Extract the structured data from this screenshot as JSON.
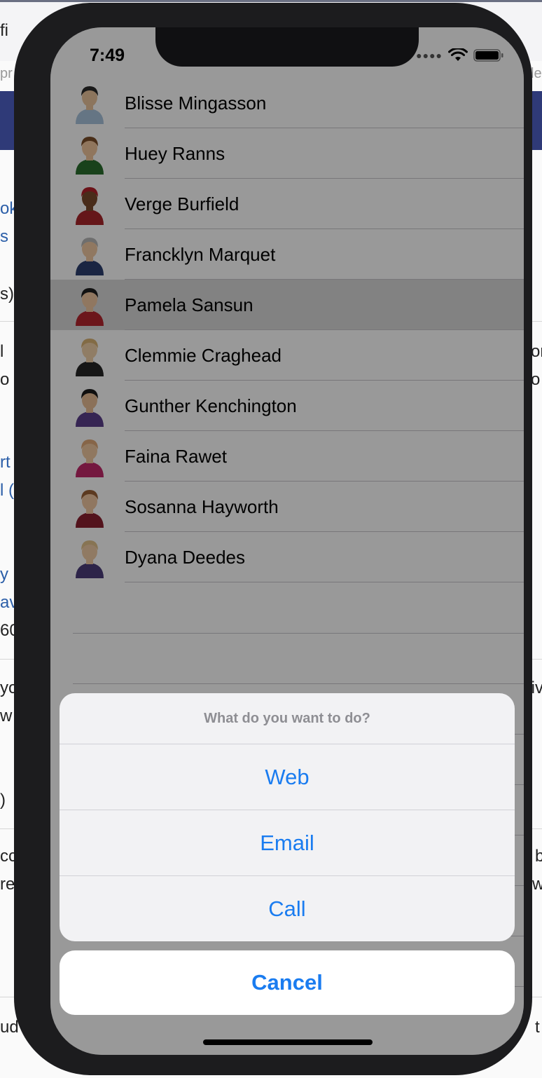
{
  "background_page": {
    "fragments": [
      {
        "text": "fi",
        "cls": ""
      },
      {
        "text": "pr",
        "cls": "grey"
      },
      {
        "text": "le",
        "cls": "grey"
      },
      {
        "text": "ok",
        "cls": "link"
      },
      {
        "text": "s",
        "cls": "link"
      },
      {
        "text": "s)",
        "cls": ""
      },
      {
        "text": "l",
        "cls": ""
      },
      {
        "text": "o y",
        "cls": ""
      },
      {
        "text": "or",
        "cls": ""
      },
      {
        "text": "o",
        "cls": ""
      },
      {
        "text": "rt",
        "cls": "link"
      },
      {
        "text": "l (",
        "cls": "link"
      },
      {
        "text": "y l",
        "cls": "link"
      },
      {
        "text": "avi",
        "cls": "link"
      },
      {
        "text": "60",
        "cls": ""
      },
      {
        "text": "yo",
        "cls": ""
      },
      {
        "text": "w",
        "cls": ""
      },
      {
        "text": "tiv",
        "cls": ""
      },
      {
        "text": ")",
        "cls": ""
      },
      {
        "text": "cc",
        "cls": ""
      },
      {
        "text": "re",
        "cls": ""
      },
      {
        "text": "b",
        "cls": ""
      },
      {
        "text": "w",
        "cls": ""
      },
      {
        "text": "ud",
        "cls": ""
      },
      {
        "text": "t",
        "cls": ""
      }
    ]
  },
  "status_bar": {
    "time": "7:49",
    "signal_icon": "signal-dots-icon",
    "wifi_icon": "wifi-icon",
    "battery_icon": "battery-icon"
  },
  "contacts": [
    {
      "name": "Blisse Mingasson",
      "avatar": {
        "skin": "#e9c39c",
        "hair": "#2b2b2b",
        "shirt": "#a9c3dc"
      },
      "selected": false
    },
    {
      "name": "Huey Ranns",
      "avatar": {
        "skin": "#f0c59b",
        "hair": "#7a4d28",
        "shirt": "#2b6e2e"
      },
      "selected": false
    },
    {
      "name": "Verge Burfield",
      "avatar": {
        "skin": "#7a4a2c",
        "hair": "#b3202a",
        "shirt": "#a8262a"
      },
      "selected": false
    },
    {
      "name": "Francklyn Marquet",
      "avatar": {
        "skin": "#f1c9a2",
        "hair": "#b7b7b7",
        "shirt": "#2c3f6e"
      },
      "selected": false
    },
    {
      "name": "Pamela Sansun",
      "avatar": {
        "skin": "#f1c6a0",
        "hair": "#1f1f1f",
        "shirt": "#b5262e"
      },
      "selected": true
    },
    {
      "name": "Clemmie Craghead",
      "avatar": {
        "skin": "#f1d0a8",
        "hair": "#d9b274",
        "shirt": "#262626"
      },
      "selected": false
    },
    {
      "name": "Gunther Kenchington",
      "avatar": {
        "skin": "#e8bd94",
        "hair": "#1b1b1b",
        "shirt": "#5a3f8a"
      },
      "selected": false
    },
    {
      "name": "Faina Rawet",
      "avatar": {
        "skin": "#f1c9a0",
        "hair": "#e0a878",
        "shirt": "#c2286a"
      },
      "selected": false
    },
    {
      "name": "Sosanna Hayworth",
      "avatar": {
        "skin": "#f1c6a0",
        "hair": "#9a6236",
        "shirt": "#8a2030"
      },
      "selected": false
    },
    {
      "name": "Dyana Deedes",
      "avatar": {
        "skin": "#f1cca5",
        "hair": "#e2c28a",
        "shirt": "#4b3d7a"
      },
      "selected": false
    }
  ],
  "action_sheet": {
    "title": "What do you want to do?",
    "actions": [
      "Web",
      "Email",
      "Call"
    ],
    "cancel": "Cancel"
  },
  "colors": {
    "accent": "#1a7cf0",
    "phone_bezel": "#1c1c1e"
  }
}
